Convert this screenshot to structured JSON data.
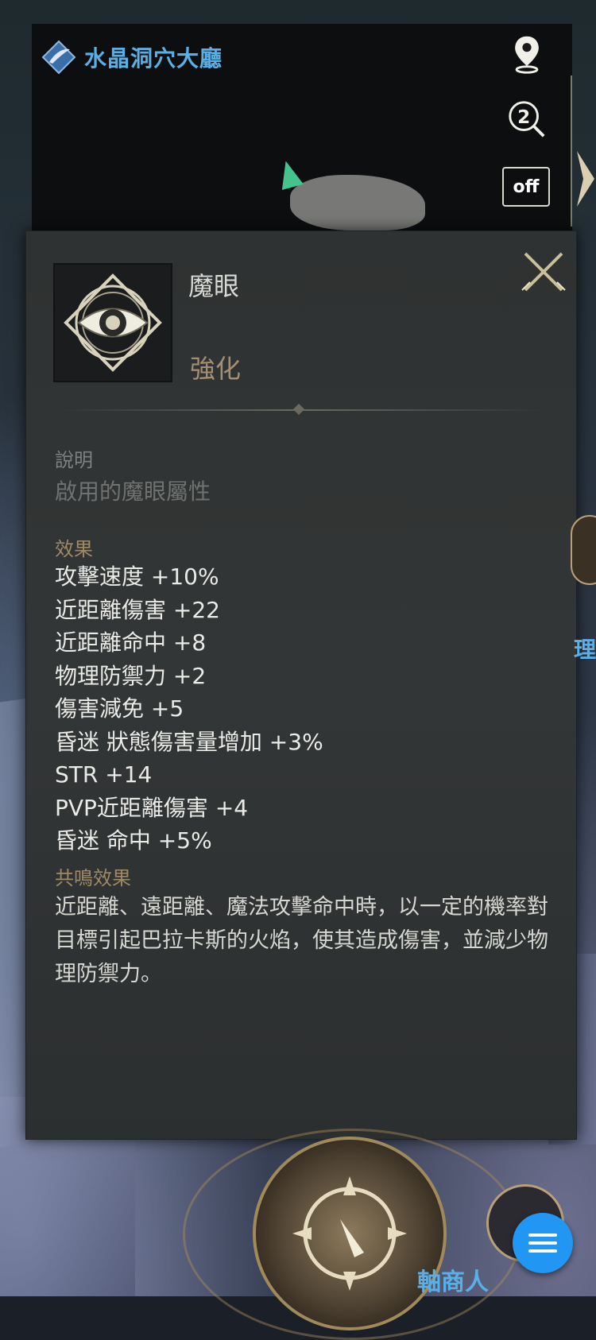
{
  "location": {
    "title": "水晶洞穴大廳",
    "icon": "feather-wing-icon"
  },
  "map_buttons": {
    "off_label": "off",
    "search_badge": "2"
  },
  "item": {
    "name": "魔眼",
    "grade": "強化",
    "icon": "magic-eye-icon",
    "description_label": "說明",
    "description": "啟用的魔眼屬性",
    "effects_label": "效果",
    "effects": [
      "攻擊速度 +10%",
      "近距離傷害 +22",
      "近距離命中 +8",
      "物理防禦力 +2",
      "傷害減免 +5",
      "昏迷 狀態傷害量增加 +3%",
      "STR +14",
      "PVP近距離傷害 +4",
      "昏迷 命中 +5%"
    ],
    "resonance_label": "共鳴效果",
    "resonance": "近距離、遠距離、魔法攻擊命中時，以一定的機率對目標引起巴拉卡斯的火焰，使其造成傷害，並減少物理防禦力。"
  },
  "hud": {
    "npc_label": "軸商人",
    "side_label": "理"
  },
  "colors": {
    "location_blue": "#5ab0e6",
    "grade_brown": "#a58f72",
    "fab_blue": "#2196f3"
  }
}
